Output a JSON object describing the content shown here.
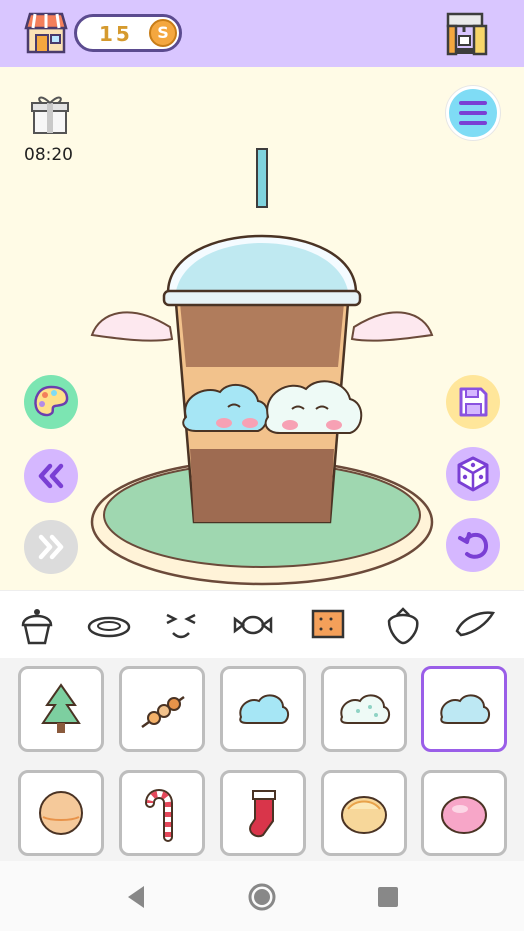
{
  "header": {
    "coins": "15",
    "coin_symbol": "S"
  },
  "stage": {
    "timer": "08:20",
    "background_color": "#fffbe6"
  },
  "side_buttons": {
    "left": [
      "palette-icon",
      "rewind-icon",
      "fast-forward-icon"
    ],
    "right": [
      "menu-icon",
      "save-icon",
      "dice-icon",
      "undo-icon"
    ]
  },
  "categories": [
    {
      "name": "cupcake",
      "icon": "cupcake-icon"
    },
    {
      "name": "plate",
      "icon": "plate-icon"
    },
    {
      "name": "face",
      "icon": "face-icon"
    },
    {
      "name": "candy",
      "icon": "candy-icon"
    },
    {
      "name": "biscuit",
      "icon": "biscuit-icon",
      "selected": true
    },
    {
      "name": "strawberry",
      "icon": "strawberry-icon"
    },
    {
      "name": "wing",
      "icon": "wing-icon"
    }
  ],
  "items": [
    {
      "icon": "tree-icon",
      "selected": false
    },
    {
      "icon": "skewer-icon",
      "selected": false
    },
    {
      "icon": "blue-cloud-icon",
      "selected": false
    },
    {
      "icon": "dotted-cloud-icon",
      "selected": false
    },
    {
      "icon": "cloud-icon",
      "selected": true
    },
    {
      "icon": "peach-ball-icon",
      "selected": false
    },
    {
      "icon": "candy-cane-icon",
      "selected": false
    },
    {
      "icon": "stocking-icon",
      "selected": false
    },
    {
      "icon": "custard-bun-icon",
      "selected": false
    },
    {
      "icon": "pink-mochi-icon",
      "selected": false
    }
  ],
  "colors": {
    "top_bar": "#d9c6ff",
    "accent_purple": "#9a5ee8",
    "coin_text": "#d59a2e"
  }
}
